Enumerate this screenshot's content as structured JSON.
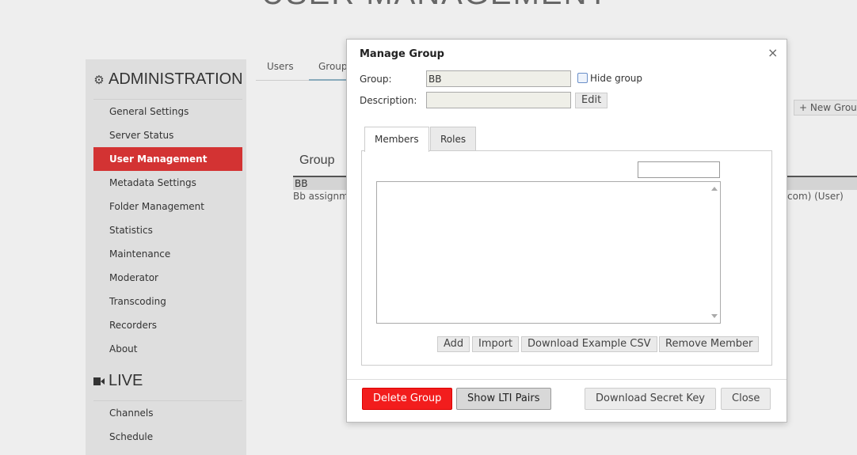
{
  "page": {
    "title": "USER MANAGEMENT"
  },
  "sidebar": {
    "administration_heading": "ADMINISTRATION",
    "admin_items": [
      {
        "label": "General Settings"
      },
      {
        "label": "Server Status"
      },
      {
        "label": "User Management"
      },
      {
        "label": "Metadata Settings"
      },
      {
        "label": "Folder Management"
      },
      {
        "label": "Statistics"
      },
      {
        "label": "Maintenance"
      },
      {
        "label": "Moderator"
      },
      {
        "label": "Transcoding"
      },
      {
        "label": "Recorders"
      },
      {
        "label": "About"
      }
    ],
    "live_heading": "LIVE",
    "live_items": [
      {
        "label": "Channels"
      },
      {
        "label": "Schedule"
      }
    ]
  },
  "background": {
    "tabs": [
      {
        "label": "Users"
      },
      {
        "label": "Groups"
      }
    ],
    "new_group_label": "+ New Group",
    "group_heading": "Group",
    "rows": [
      {
        "name": "BB",
        "description": "Bb assignme",
        "members": "com) (User)"
      }
    ]
  },
  "modal": {
    "title": "Manage Group",
    "close_glyph": "×",
    "group_label": "Group:",
    "group_value": "BB",
    "hide_group_label": "Hide group",
    "description_label": "Description:",
    "description_value": "",
    "edit_label": "Edit",
    "tabs": [
      {
        "label": "Members"
      },
      {
        "label": "Roles"
      }
    ],
    "member_actions": {
      "add": "Add",
      "import": "Import",
      "download_csv": "Download Example CSV",
      "remove": "Remove Member"
    },
    "footer": {
      "delete": "Delete Group",
      "show_lti": "Show LTI Pairs",
      "download_key": "Download Secret Key",
      "close": "Close"
    }
  },
  "colors": {
    "accent_red": "#d33333",
    "danger_button": "#f21d1d"
  }
}
